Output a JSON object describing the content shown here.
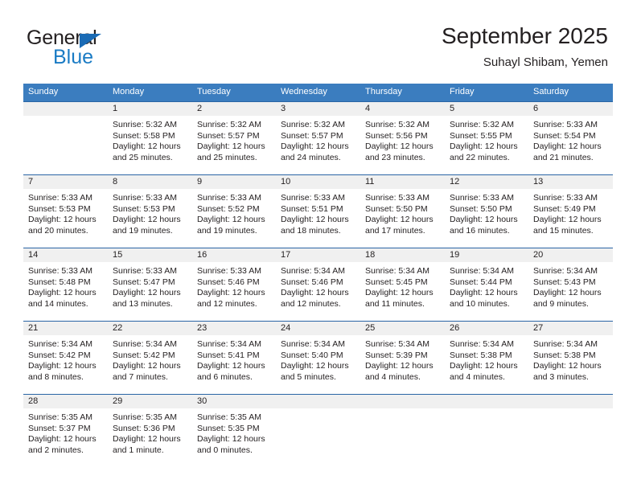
{
  "brand": {
    "name_top": "General",
    "name_bottom": "Blue",
    "triangle_color": "#1a6bb5",
    "blue_text_color": "#1a7bc4"
  },
  "header": {
    "title": "September 2025",
    "subtitle": "Suhayl Shibam, Yemen"
  },
  "theme": {
    "header_row_bg": "#3b7dbf",
    "row_divider": "#2a65a5",
    "date_band_bg": "#f0f0f0",
    "text": "#231f20"
  },
  "weekdays": [
    "Sunday",
    "Monday",
    "Tuesday",
    "Wednesday",
    "Thursday",
    "Friday",
    "Saturday"
  ],
  "weeks": [
    [
      {
        "date": "",
        "sunrise": "",
        "sunset": "",
        "daylight_1": "",
        "daylight_2": ""
      },
      {
        "date": "1",
        "sunrise": "Sunrise: 5:32 AM",
        "sunset": "Sunset: 5:58 PM",
        "daylight_1": "Daylight: 12 hours",
        "daylight_2": "and 25 minutes."
      },
      {
        "date": "2",
        "sunrise": "Sunrise: 5:32 AM",
        "sunset": "Sunset: 5:57 PM",
        "daylight_1": "Daylight: 12 hours",
        "daylight_2": "and 25 minutes."
      },
      {
        "date": "3",
        "sunrise": "Sunrise: 5:32 AM",
        "sunset": "Sunset: 5:57 PM",
        "daylight_1": "Daylight: 12 hours",
        "daylight_2": "and 24 minutes."
      },
      {
        "date": "4",
        "sunrise": "Sunrise: 5:32 AM",
        "sunset": "Sunset: 5:56 PM",
        "daylight_1": "Daylight: 12 hours",
        "daylight_2": "and 23 minutes."
      },
      {
        "date": "5",
        "sunrise": "Sunrise: 5:32 AM",
        "sunset": "Sunset: 5:55 PM",
        "daylight_1": "Daylight: 12 hours",
        "daylight_2": "and 22 minutes."
      },
      {
        "date": "6",
        "sunrise": "Sunrise: 5:33 AM",
        "sunset": "Sunset: 5:54 PM",
        "daylight_1": "Daylight: 12 hours",
        "daylight_2": "and 21 minutes."
      }
    ],
    [
      {
        "date": "7",
        "sunrise": "Sunrise: 5:33 AM",
        "sunset": "Sunset: 5:53 PM",
        "daylight_1": "Daylight: 12 hours",
        "daylight_2": "and 20 minutes."
      },
      {
        "date": "8",
        "sunrise": "Sunrise: 5:33 AM",
        "sunset": "Sunset: 5:53 PM",
        "daylight_1": "Daylight: 12 hours",
        "daylight_2": "and 19 minutes."
      },
      {
        "date": "9",
        "sunrise": "Sunrise: 5:33 AM",
        "sunset": "Sunset: 5:52 PM",
        "daylight_1": "Daylight: 12 hours",
        "daylight_2": "and 19 minutes."
      },
      {
        "date": "10",
        "sunrise": "Sunrise: 5:33 AM",
        "sunset": "Sunset: 5:51 PM",
        "daylight_1": "Daylight: 12 hours",
        "daylight_2": "and 18 minutes."
      },
      {
        "date": "11",
        "sunrise": "Sunrise: 5:33 AM",
        "sunset": "Sunset: 5:50 PM",
        "daylight_1": "Daylight: 12 hours",
        "daylight_2": "and 17 minutes."
      },
      {
        "date": "12",
        "sunrise": "Sunrise: 5:33 AM",
        "sunset": "Sunset: 5:50 PM",
        "daylight_1": "Daylight: 12 hours",
        "daylight_2": "and 16 minutes."
      },
      {
        "date": "13",
        "sunrise": "Sunrise: 5:33 AM",
        "sunset": "Sunset: 5:49 PM",
        "daylight_1": "Daylight: 12 hours",
        "daylight_2": "and 15 minutes."
      }
    ],
    [
      {
        "date": "14",
        "sunrise": "Sunrise: 5:33 AM",
        "sunset": "Sunset: 5:48 PM",
        "daylight_1": "Daylight: 12 hours",
        "daylight_2": "and 14 minutes."
      },
      {
        "date": "15",
        "sunrise": "Sunrise: 5:33 AM",
        "sunset": "Sunset: 5:47 PM",
        "daylight_1": "Daylight: 12 hours",
        "daylight_2": "and 13 minutes."
      },
      {
        "date": "16",
        "sunrise": "Sunrise: 5:33 AM",
        "sunset": "Sunset: 5:46 PM",
        "daylight_1": "Daylight: 12 hours",
        "daylight_2": "and 12 minutes."
      },
      {
        "date": "17",
        "sunrise": "Sunrise: 5:34 AM",
        "sunset": "Sunset: 5:46 PM",
        "daylight_1": "Daylight: 12 hours",
        "daylight_2": "and 12 minutes."
      },
      {
        "date": "18",
        "sunrise": "Sunrise: 5:34 AM",
        "sunset": "Sunset: 5:45 PM",
        "daylight_1": "Daylight: 12 hours",
        "daylight_2": "and 11 minutes."
      },
      {
        "date": "19",
        "sunrise": "Sunrise: 5:34 AM",
        "sunset": "Sunset: 5:44 PM",
        "daylight_1": "Daylight: 12 hours",
        "daylight_2": "and 10 minutes."
      },
      {
        "date": "20",
        "sunrise": "Sunrise: 5:34 AM",
        "sunset": "Sunset: 5:43 PM",
        "daylight_1": "Daylight: 12 hours",
        "daylight_2": "and 9 minutes."
      }
    ],
    [
      {
        "date": "21",
        "sunrise": "Sunrise: 5:34 AM",
        "sunset": "Sunset: 5:42 PM",
        "daylight_1": "Daylight: 12 hours",
        "daylight_2": "and 8 minutes."
      },
      {
        "date": "22",
        "sunrise": "Sunrise: 5:34 AM",
        "sunset": "Sunset: 5:42 PM",
        "daylight_1": "Daylight: 12 hours",
        "daylight_2": "and 7 minutes."
      },
      {
        "date": "23",
        "sunrise": "Sunrise: 5:34 AM",
        "sunset": "Sunset: 5:41 PM",
        "daylight_1": "Daylight: 12 hours",
        "daylight_2": "and 6 minutes."
      },
      {
        "date": "24",
        "sunrise": "Sunrise: 5:34 AM",
        "sunset": "Sunset: 5:40 PM",
        "daylight_1": "Daylight: 12 hours",
        "daylight_2": "and 5 minutes."
      },
      {
        "date": "25",
        "sunrise": "Sunrise: 5:34 AM",
        "sunset": "Sunset: 5:39 PM",
        "daylight_1": "Daylight: 12 hours",
        "daylight_2": "and 4 minutes."
      },
      {
        "date": "26",
        "sunrise": "Sunrise: 5:34 AM",
        "sunset": "Sunset: 5:38 PM",
        "daylight_1": "Daylight: 12 hours",
        "daylight_2": "and 4 minutes."
      },
      {
        "date": "27",
        "sunrise": "Sunrise: 5:34 AM",
        "sunset": "Sunset: 5:38 PM",
        "daylight_1": "Daylight: 12 hours",
        "daylight_2": "and 3 minutes."
      }
    ],
    [
      {
        "date": "28",
        "sunrise": "Sunrise: 5:35 AM",
        "sunset": "Sunset: 5:37 PM",
        "daylight_1": "Daylight: 12 hours",
        "daylight_2": "and 2 minutes."
      },
      {
        "date": "29",
        "sunrise": "Sunrise: 5:35 AM",
        "sunset": "Sunset: 5:36 PM",
        "daylight_1": "Daylight: 12 hours",
        "daylight_2": "and 1 minute."
      },
      {
        "date": "30",
        "sunrise": "Sunrise: 5:35 AM",
        "sunset": "Sunset: 5:35 PM",
        "daylight_1": "Daylight: 12 hours",
        "daylight_2": "and 0 minutes."
      },
      {
        "date": "",
        "sunrise": "",
        "sunset": "",
        "daylight_1": "",
        "daylight_2": ""
      },
      {
        "date": "",
        "sunrise": "",
        "sunset": "",
        "daylight_1": "",
        "daylight_2": ""
      },
      {
        "date": "",
        "sunrise": "",
        "sunset": "",
        "daylight_1": "",
        "daylight_2": ""
      },
      {
        "date": "",
        "sunrise": "",
        "sunset": "",
        "daylight_1": "",
        "daylight_2": ""
      }
    ]
  ]
}
